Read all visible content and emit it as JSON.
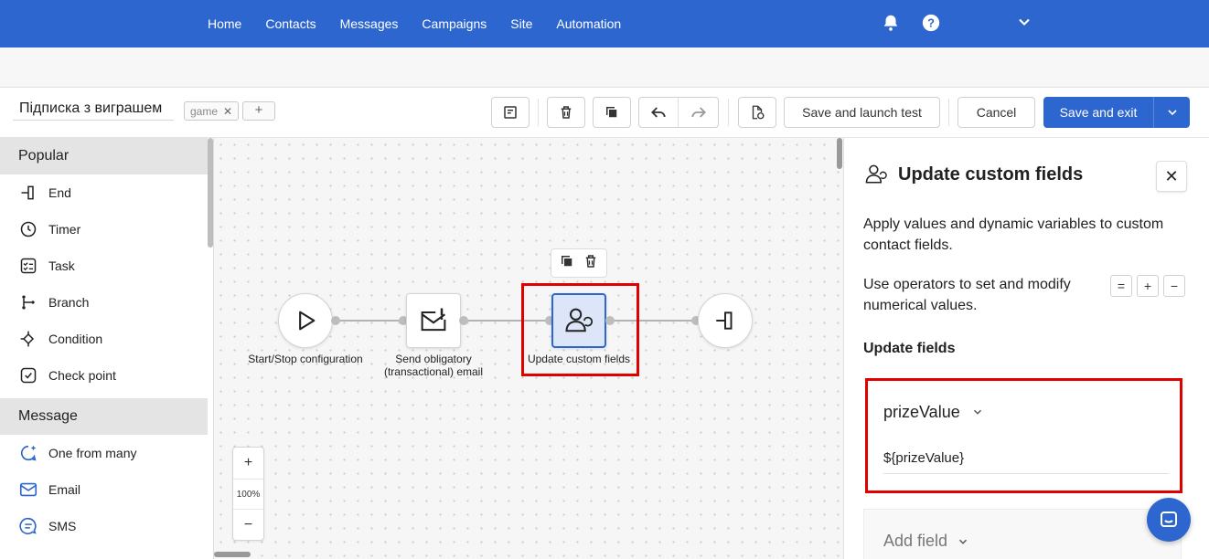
{
  "nav": {
    "items": [
      "Home",
      "Contacts",
      "Messages",
      "Campaigns",
      "Site",
      "Automation"
    ],
    "icons": [
      "bell-icon",
      "help-icon",
      "chevron-down-icon"
    ]
  },
  "toolbar": {
    "workflow_name": "Підписка з виграшем",
    "tag": "game",
    "tag_add": "+",
    "save_launch_test": "Save and launch test",
    "cancel": "Cancel",
    "save_exit": "Save and exit"
  },
  "sidebar": {
    "sections": [
      {
        "title": "Popular",
        "items": [
          {
            "label": "End",
            "icon": "end-icon"
          },
          {
            "label": "Timer",
            "icon": "timer-icon"
          },
          {
            "label": "Task",
            "icon": "task-icon"
          },
          {
            "label": "Branch",
            "icon": "branch-icon"
          },
          {
            "label": "Condition",
            "icon": "condition-icon"
          },
          {
            "label": "Check point",
            "icon": "check-point-icon"
          }
        ]
      },
      {
        "title": "Message",
        "items": [
          {
            "label": "One from many",
            "icon": "one-from-many-icon"
          },
          {
            "label": "Email",
            "icon": "email-icon"
          },
          {
            "label": "SMS",
            "icon": "sms-icon"
          }
        ]
      }
    ]
  },
  "canvas": {
    "nodes": [
      {
        "label": "Start/Stop configuration"
      },
      {
        "label": "Send obligatory",
        "label2": "(transactional) email"
      },
      {
        "label": "Update custom fields"
      }
    ],
    "zoom": {
      "in": "+",
      "level": "100%",
      "out": "−"
    }
  },
  "panel": {
    "title": "Update custom fields",
    "description": "Apply values and dynamic variables to custom contact fields.",
    "operators_text": "Use operators to set and modify numerical values.",
    "operators": [
      "=",
      "+",
      "−"
    ],
    "section_title": "Update fields",
    "field": {
      "name": "prizeValue",
      "value": "${prizeValue}"
    },
    "add_field": "Add field",
    "close": "✕"
  },
  "colors": {
    "brand": "#2e66cf",
    "highlight": "#e00000"
  }
}
